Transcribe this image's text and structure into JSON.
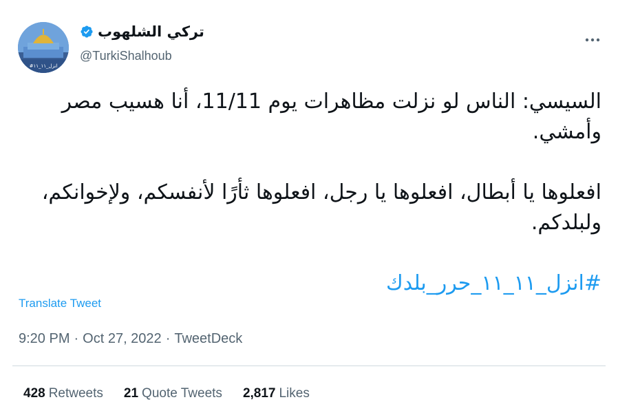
{
  "author": {
    "name": "تركي الشلهوب",
    "handle": "@TurkiShalhoub",
    "avatar_caption": "#انزل_١١_١١"
  },
  "tweet": {
    "paragraph1": "السيسي: الناس لو نزلت مظاهرات يوم 11/11، أنا هسيب مصر وأمشي.",
    "paragraph2": "افعلوها يا أبطال، افعلوها يا رجل، افعلوها ثأرًا لأنفسكم، ولإخوانكم، ولبلدكم.",
    "hashtag": "#انزل_١١_١١_حرر_بلدك"
  },
  "translate_label": "Translate Tweet",
  "meta": {
    "time": "9:20 PM",
    "separator1": "·",
    "date": "Oct 27, 2022",
    "separator2": "·",
    "source": "TweetDeck"
  },
  "stats": {
    "retweets_count": "428",
    "retweets_label": "Retweets",
    "quotes_count": "21",
    "quotes_label": "Quote Tweets",
    "likes_count": "2,817",
    "likes_label": "Likes"
  },
  "colors": {
    "accent": "#1d9bf0",
    "text": "#0f1419",
    "secondary": "#536471",
    "divider": "#cfd9de"
  },
  "icons": {
    "verified": "verified-badge-icon",
    "more": "more-horizontal-icon"
  }
}
